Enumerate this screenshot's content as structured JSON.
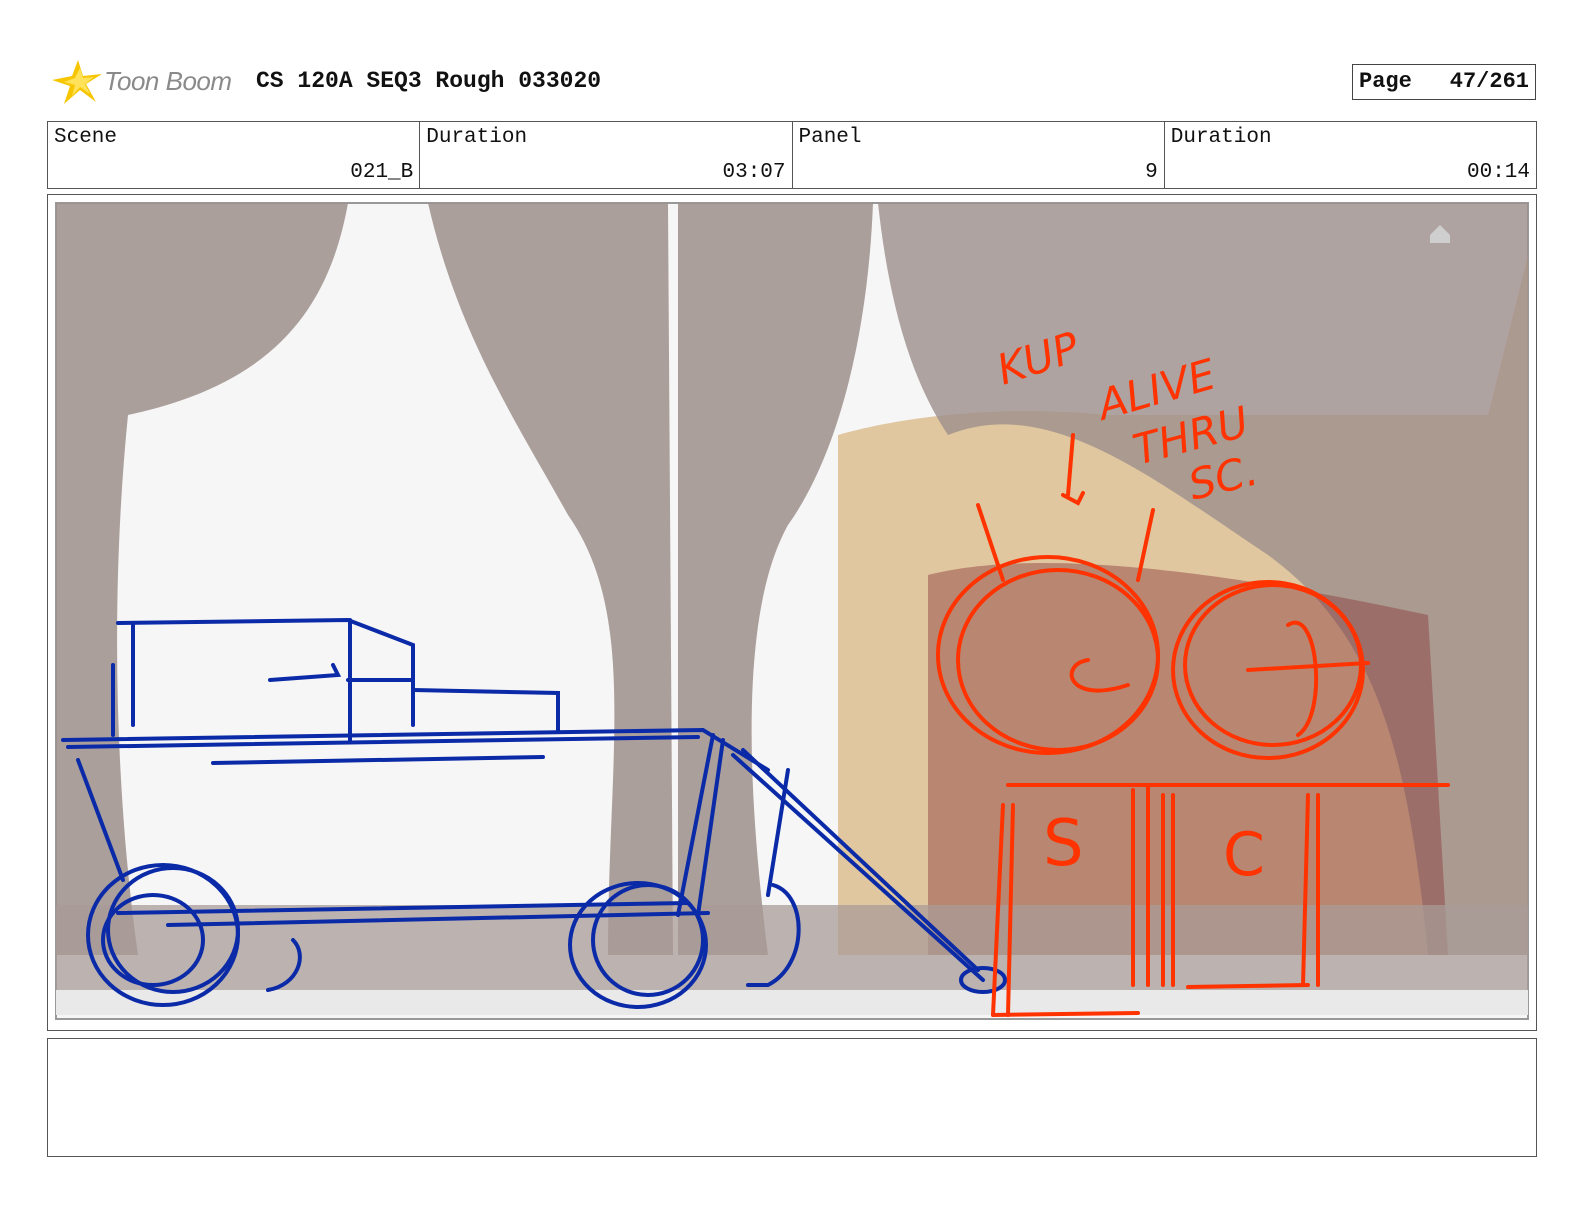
{
  "header": {
    "logo_text": "Toon Boom",
    "title": "CS 120A SEQ3 Rough 033020",
    "page_label": "Page",
    "page_number": "47/261"
  },
  "info": {
    "scene_label": "Scene",
    "scene_value": "021_B",
    "duration_label": "Duration",
    "duration_value": "03:07",
    "panel_label": "Panel",
    "panel_value": "9",
    "panel_duration_label": "Duration",
    "panel_duration_value": "00:14"
  },
  "panel": {
    "note_lines": [
      "KUP",
      "ALIVE",
      "THRU",
      "SC."
    ],
    "label_s": "S",
    "label_c": "C",
    "colors": {
      "blue_sketch": "#0a2aa8",
      "red_sketch": "#ff3300",
      "curtain": "#9e8f8c"
    }
  },
  "notes": {
    "text": ""
  }
}
